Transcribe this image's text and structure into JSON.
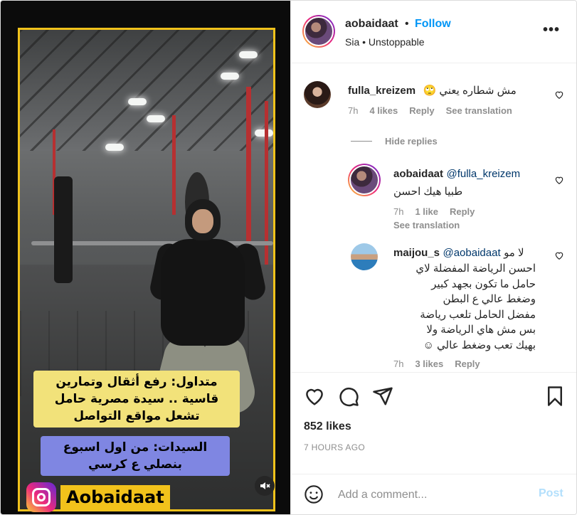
{
  "media": {
    "caption_primary": "متداول: رفع أثقال وتمارين قاسية .. سيدة مصرية حامل تشعل مواقع التواصل",
    "caption_secondary": "السيدات: من اول اسبوع بنصلي ع كرسي",
    "brand": "Aobaidaat",
    "mute_icon": "speaker-muted-icon",
    "frame_color": "#f0c21b"
  },
  "header": {
    "username": "aobaidaat",
    "separator": "•",
    "follow_label": "Follow",
    "audio": "Sia • Unstoppable",
    "more_label": "•••"
  },
  "comments": [
    {
      "username": "fulla_kreizem",
      "text": "مش شطاره يعني 🙄",
      "time": "7h",
      "likes": "4 likes",
      "reply": "Reply",
      "translation": "See translation"
    }
  ],
  "hide_replies": "Hide replies",
  "replies": [
    {
      "username": "aobaidaat",
      "mention": "@fulla_kreizem",
      "text": "طبيا هيك احسن",
      "time": "7h",
      "likes": "1 like",
      "reply": "Reply",
      "translation": "See translation"
    },
    {
      "username": "maijou_s",
      "mention": "@aobaidaat",
      "text_lines": [
        "لا مو",
        "احسن الرياضة المفضلة لاي",
        "حامل ما تكون بجهد كبير",
        "وضغط عالي ع البطن",
        "مفضل الحامل تلعب رياضة",
        "بس مش هاي الرياضة ولا",
        "بهيك تعب وضغط عالي ☺"
      ],
      "time": "7h",
      "likes": "3 likes",
      "reply": "Reply"
    }
  ],
  "footer": {
    "likes": "852 likes",
    "posted": "7 HOURS AGO",
    "add_comment_placeholder": "Add a comment...",
    "post_label": "Post"
  },
  "colors": {
    "accent": "#0095f6",
    "post_disabled": "#b2dffc",
    "muted_text": "#8e8e8e"
  }
}
